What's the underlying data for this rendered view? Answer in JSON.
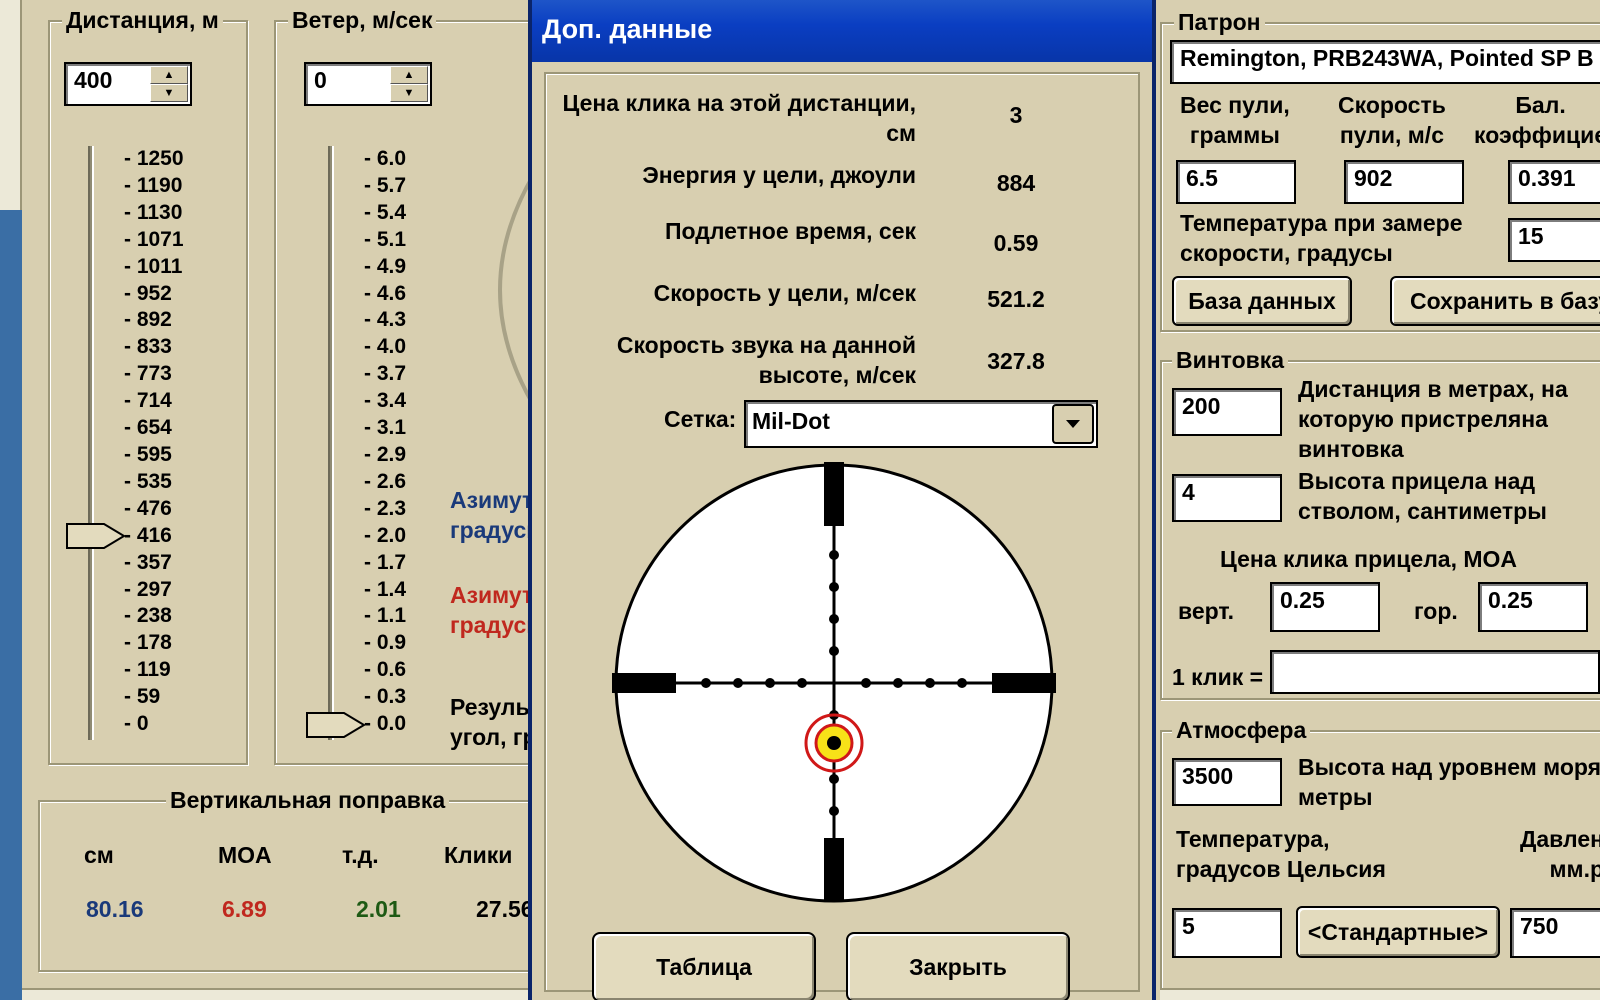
{
  "distance": {
    "title": "Дистанция, м",
    "value": "400",
    "ticks": [
      "- 1250",
      "- 1190",
      "- 1130",
      "- 1071",
      "- 1011",
      "- 952",
      "- 892",
      "- 833",
      "- 773",
      "- 714",
      "- 654",
      "- 595",
      "- 535",
      "- 476",
      "- 416",
      "- 357",
      "- 297",
      "- 238",
      "- 178",
      "- 119",
      "- 59",
      "- 0"
    ],
    "slider_value": 416
  },
  "wind": {
    "title": "Ветер, м/сек",
    "value": "0",
    "ticks": [
      "- 6.0",
      "- 5.7",
      "- 5.4",
      "- 5.1",
      "- 4.9",
      "- 4.6",
      "- 4.3",
      "- 4.0",
      "- 3.7",
      "- 3.4",
      "- 3.1",
      "- 2.9",
      "- 2.6",
      "- 2.3",
      "- 2.0",
      "- 1.7",
      "- 1.4",
      "- 1.1",
      "- 0.9",
      "- 0.6",
      "- 0.3",
      "- 0.0"
    ],
    "slider_value": 0.0
  },
  "partial_labels": {
    "azimuth1_l1": "Азимут",
    "azimuth1_l2": "градусы",
    "azimuth2_l1": "Азимут",
    "azimuth2_l2": "градусы",
    "result_l1": "Результ",
    "result_l2": "угол, гр"
  },
  "vertical": {
    "title": "Вертикальная поправка",
    "headers": [
      "см",
      "MOA",
      "т.д.",
      "Клики"
    ],
    "values": [
      "80.16",
      "6.89",
      "2.01",
      "27.56"
    ]
  },
  "dialog": {
    "title": "Доп. данные",
    "rows": [
      {
        "label_l1": "Цена клика на этой дистанции,",
        "label_l2": "см",
        "value": "3"
      },
      {
        "label_l1": "Энергия у цели, джоули",
        "label_l2": "",
        "value": "884"
      },
      {
        "label_l1": "Подлетное время, сек",
        "label_l2": "",
        "value": "0.59"
      },
      {
        "label_l1": "Скорость у цели, м/сек",
        "label_l2": "",
        "value": "521.2"
      },
      {
        "label_l1": "Скорость звука на данной",
        "label_l2": "высоте, м/сек",
        "value": "327.8"
      }
    ],
    "reticle_label": "Сетка:",
    "reticle_value": "Mil-Dot",
    "table_button": "Таблица",
    "close_button": "Закрыть"
  },
  "cartridge": {
    "title": "Патрон",
    "name": "Remington, PRB243WA, Pointed SP B",
    "weight_label_l1": "Вес пули,",
    "weight_label_l2": "граммы",
    "speed_label_l1": "Скорость",
    "speed_label_l2": "пули, м/с",
    "bc_label_l1": "Бал.",
    "bc_label_l2": "коэффицие",
    "weight": "6.5",
    "speed": "902",
    "bc": "0.391",
    "temp_label_l1": "Температура при замере",
    "temp_label_l2": "скорости, градусы",
    "temp": "15",
    "db_button": "База данных",
    "save_button": "Сохранить в базу"
  },
  "rifle": {
    "title": "Винтовка",
    "zero_distance": "200",
    "zero_label_l1": "Дистанция в метрах, на",
    "zero_label_l2": "которую пристреляна",
    "zero_label_l3": "винтовка",
    "sight_height": "4",
    "sight_label_l1": "Высота прицела над",
    "sight_label_l2": "стволом, сантиметры",
    "click_title": "Цена клика прицела, MOA",
    "vert_label": "верт.",
    "vert": "0.25",
    "hor_label": "гор.",
    "hor": "0.25",
    "one_click_label": "1 клик =",
    "one_click_value": ""
  },
  "atmosphere": {
    "title": "Атмосфера",
    "altitude": "3500",
    "altitude_label_l1": "Высота над уровнем моря,",
    "altitude_label_l2": "метры",
    "temp_label_l1": "Температура,",
    "temp_label_l2": "градусов Цельсия",
    "pressure_label_l1": "Давлен",
    "pressure_label_l2": "мм.р",
    "temp": "5",
    "standard_button": "<Стандартные>",
    "pressure": "750"
  },
  "colors": {
    "panel": "#d8cfb0",
    "title_bar": "#0a3ec2",
    "value_blue": "#1a3a7a",
    "value_red": "#c0281e",
    "value_green": "#1e5a14"
  }
}
